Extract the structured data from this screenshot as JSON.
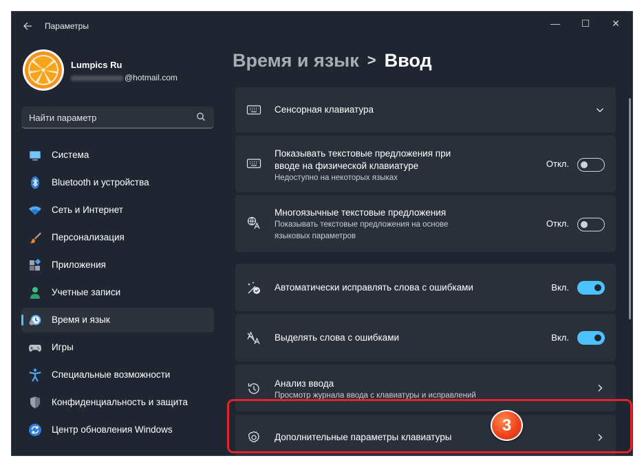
{
  "window": {
    "title": "Параметры",
    "controls": {
      "minimize": "—",
      "maximize": "☐",
      "close": "✕"
    }
  },
  "profile": {
    "name": "Lumpics Ru",
    "email_domain": "@hotmail.com"
  },
  "search": {
    "placeholder": "Найти параметр",
    "icon": "search-icon"
  },
  "sidebar": {
    "items": [
      {
        "label": "Система",
        "icon": "display-icon",
        "active": false
      },
      {
        "label": "Bluetooth и устройства",
        "icon": "bluetooth-icon",
        "active": false
      },
      {
        "label": "Сеть и Интернет",
        "icon": "wifi-icon",
        "active": false
      },
      {
        "label": "Персонализация",
        "icon": "brush-icon",
        "active": false
      },
      {
        "label": "Приложения",
        "icon": "apps-icon",
        "active": false
      },
      {
        "label": "Учетные записи",
        "icon": "person-icon",
        "active": false
      },
      {
        "label": "Время и язык",
        "icon": "clock-globe-icon",
        "active": true
      },
      {
        "label": "Игры",
        "icon": "gamepad-icon",
        "active": false
      },
      {
        "label": "Специальные возможности",
        "icon": "accessibility-icon",
        "active": false
      },
      {
        "label": "Конфиденциальность и защита",
        "icon": "shield-icon",
        "active": false
      },
      {
        "label": "Центр обновления Windows",
        "icon": "update-icon",
        "active": false
      }
    ]
  },
  "header": {
    "parent": "Время и язык",
    "separator": ">",
    "current": "Ввод"
  },
  "cards": [
    {
      "title": "Сенсорная клавиатура",
      "icon": "keyboard-icon",
      "action": "expand"
    },
    {
      "title": "Показывать текстовые предложения при вводе на физической клавиатуре",
      "title_line1": "Показывать текстовые предложения при",
      "title_line2": "вводе на физической клавиатуре",
      "desc": "Недоступно на некоторых языках",
      "icon": "keyboard-icon",
      "state": "Откл.",
      "toggle": false
    },
    {
      "title": "Многоязычные текстовые предложения",
      "desc_line1": "Показывать текстовые предложения на основе",
      "desc_line2": "языковых параметров",
      "icon": "language-icon",
      "state": "Откл.",
      "toggle": false
    },
    {
      "title": "Автоматически исправлять слова с ошибками",
      "icon": "autocorrect-icon",
      "state": "Вкл.",
      "toggle": true
    },
    {
      "title": "Выделять слова с ошибками",
      "icon": "spellcheck-icon",
      "state": "Вкл.",
      "toggle": true
    },
    {
      "title": "Анализ ввода",
      "desc": "Просмотр журнала ввода с клавиатуры и исправлений",
      "icon": "history-icon",
      "action": "navigate"
    },
    {
      "title": "Дополнительные параметры клавиатуры",
      "icon": "gear-icon",
      "action": "navigate"
    }
  ],
  "annotation": {
    "step": "3",
    "color": "#e3232c"
  },
  "colors": {
    "accent": "#4cc2ff",
    "background": "#1f2632",
    "card": "#2a303a"
  }
}
